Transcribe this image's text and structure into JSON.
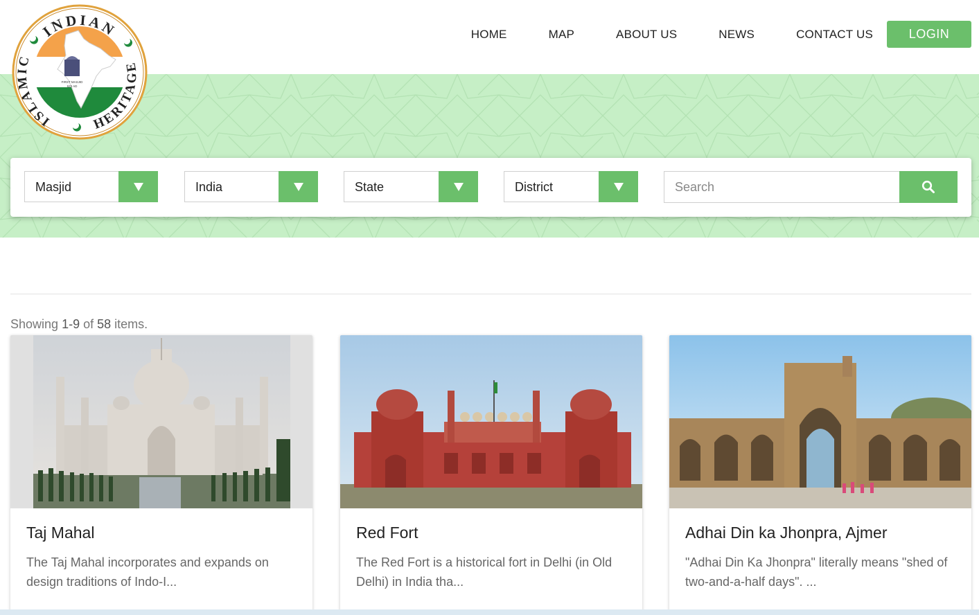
{
  "logo": {
    "top_text": "INDIAN",
    "left_text": "ISLAMIC",
    "right_text": "HERITAGE",
    "caption_line1": "FIRST MASJID",
    "caption_line2": "622 AD"
  },
  "nav": {
    "items": [
      "HOME",
      "MAP",
      "ABOUT US",
      "NEWS",
      "CONTACT US"
    ],
    "login_label": "LOGIN"
  },
  "filters": {
    "type": "Masjid",
    "country": "India",
    "state": "State",
    "district": "District",
    "search_placeholder": "Search"
  },
  "results": {
    "prefix": "Showing",
    "range": "1-9",
    "of": "of",
    "total": "58",
    "suffix": "items."
  },
  "cards": [
    {
      "title": "Taj Mahal",
      "description": "The Taj Mahal incorporates and expands on design traditions of Indo-I..."
    },
    {
      "title": "Red Fort",
      "description": "The Red Fort is a historical fort in Delhi (in Old Delhi) in India tha..."
    },
    {
      "title": "Adhai Din ka Jhonpra, Ajmer",
      "description": "\"Adhai Din Ka Jhonpra\" literally means \"shed of two-and-a-half days\". ..."
    }
  ],
  "colors": {
    "accent": "#6bbf6b",
    "hero": "#c6efc6",
    "logo_saffron": "#f4a24a",
    "logo_green": "#1f8a3c"
  }
}
